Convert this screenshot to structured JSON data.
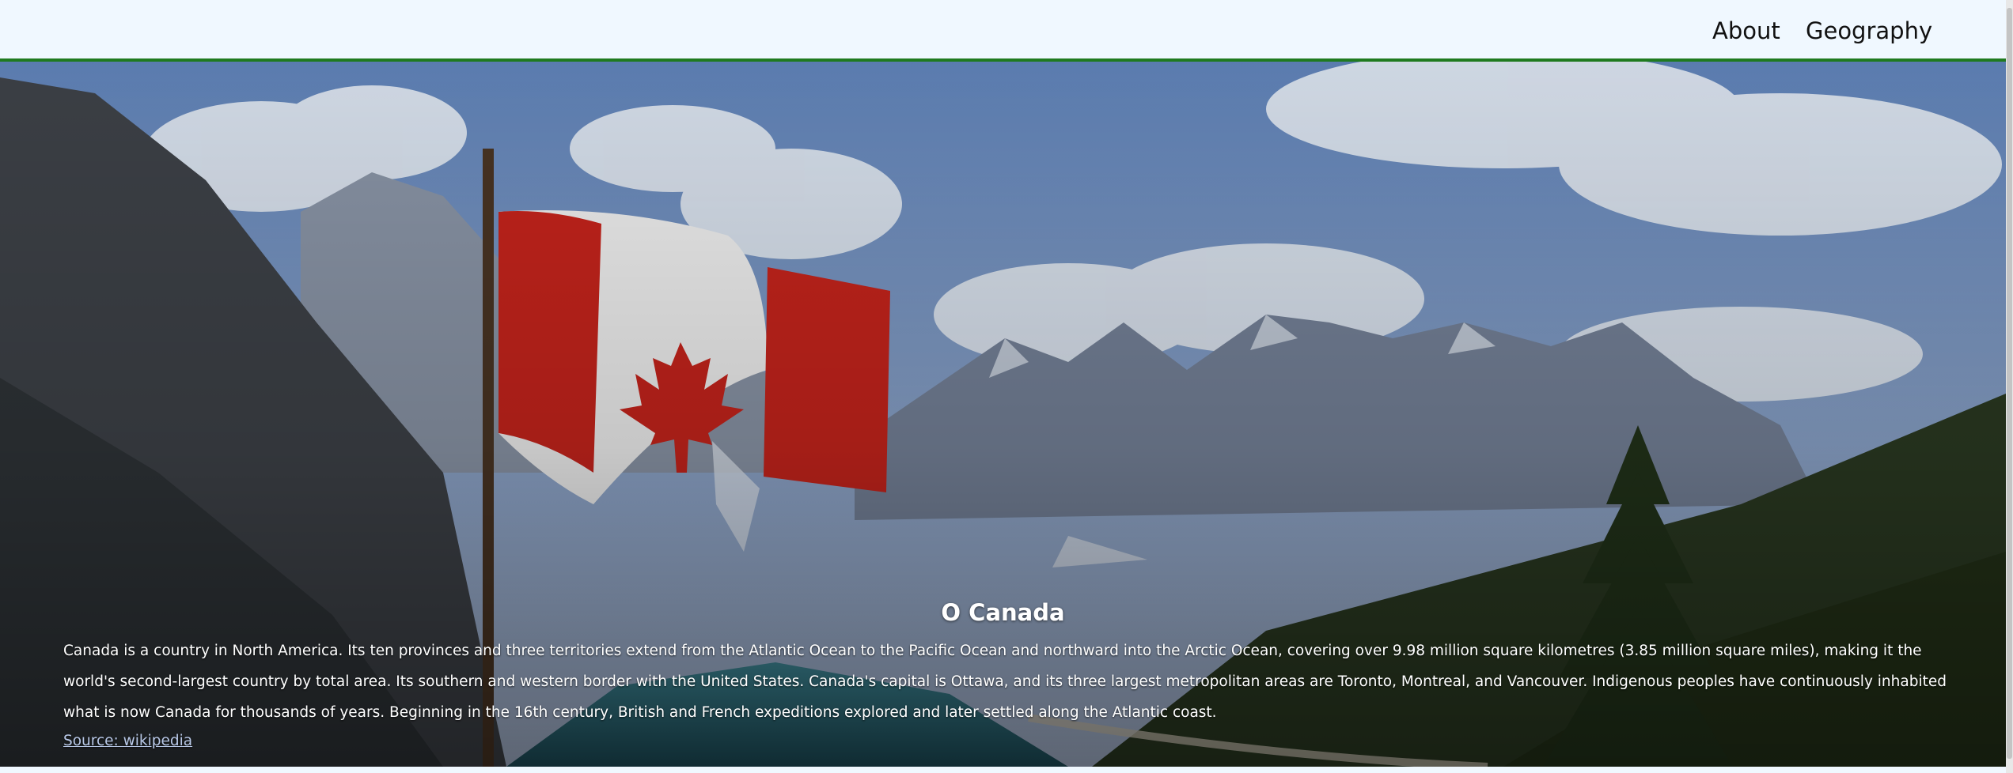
{
  "nav": {
    "items": [
      {
        "label": "About"
      },
      {
        "label": "Geography"
      }
    ]
  },
  "hero": {
    "title": "O Canada",
    "body": "Canada is a country in North America. Its ten provinces and three territories extend from the Atlantic Ocean to the Pacific Ocean and northward into the Arctic Ocean, covering over 9.98 million square kilometres (3.85 million square miles), making it the world's second-largest country by total area. Its southern and western border with the United States. Canada's capital is Ottawa, and its three largest metropolitan areas are Toronto, Montreal, and Vancouver. Indigenous peoples have continuously inhabited what is now Canada for thousands of years. Beginning in the 16th century, British and French expeditions explored and later settled along the Atlantic coast.",
    "source_link": "Source: wikipedia",
    "image_subject": "canadian-flag-mountain-lake"
  },
  "colors": {
    "nav_background": "#f0f8ff",
    "nav_border": "#1f7a1f",
    "flag_red": "#d52b1e",
    "link": "#b9c9e8"
  }
}
